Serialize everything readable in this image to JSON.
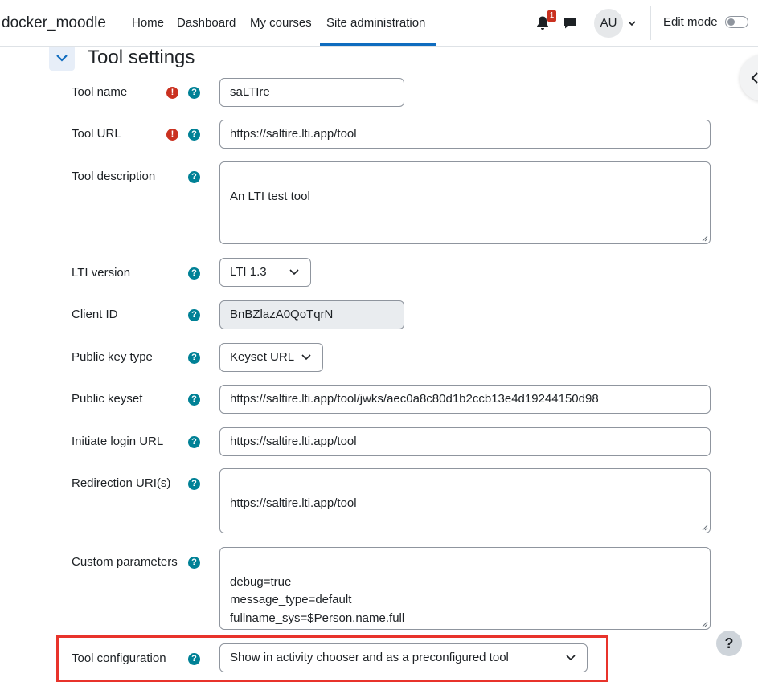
{
  "navbar": {
    "brand": "docker_moodle",
    "links": [
      "Home",
      "Dashboard",
      "My courses",
      "Site administration"
    ],
    "active_link": "Site administration",
    "notification_count": "1",
    "avatar_initials": "AU",
    "edit_mode_label": "Edit mode",
    "edit_mode_on": false
  },
  "section": {
    "title": "Tool settings"
  },
  "form": {
    "tool_name": {
      "label": "Tool name",
      "value": "saLTIre",
      "required": true
    },
    "tool_url": {
      "label": "Tool URL",
      "value": "https://saltire.lti.app/tool",
      "required": true
    },
    "tool_description": {
      "label": "Tool description",
      "value": "An LTI test tool"
    },
    "lti_version": {
      "label": "LTI version",
      "value": "LTI 1.3"
    },
    "client_id": {
      "label": "Client ID",
      "value": "BnBZlazA0QoTqrN"
    },
    "public_key_type": {
      "label": "Public key type",
      "value": "Keyset URL"
    },
    "public_keyset": {
      "label": "Public keyset",
      "value": "https://saltire.lti.app/tool/jwks/aec0a8c80d1b2ccb13e4d19244150d98"
    },
    "initiate_login_url": {
      "label": "Initiate login URL",
      "value": "https://saltire.lti.app/tool"
    },
    "redirection_uris": {
      "label": "Redirection URI(s)",
      "value": "https://saltire.lti.app/tool"
    },
    "custom_parameters": {
      "label": "Custom parameters",
      "value": "debug=true\nmessage_type=default\nfullname_sys=$Person.name.full"
    },
    "tool_configuration_usage": {
      "label": "Tool configuration",
      "value": "Show in activity chooser and as a preconfigured tool"
    }
  },
  "icons": {
    "required": "!",
    "help": "?",
    "help_fab": "?"
  },
  "colors": {
    "accent": "#0f6cbf",
    "required": "#ca3120",
    "help": "#008196",
    "highlight": "#e8332b"
  }
}
